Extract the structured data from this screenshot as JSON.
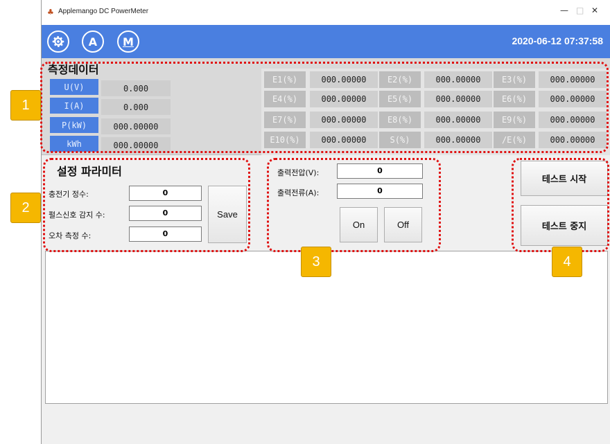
{
  "window": {
    "title": "Applemango DC PowerMeter",
    "icon": "apple-icon",
    "controls": [
      "—",
      "□",
      "✕"
    ]
  },
  "toolbar": {
    "icons": [
      "gear-icon",
      "auto-mode-icon",
      "manual-mode-icon"
    ],
    "auto_letter": "A",
    "manual_letter": "M",
    "datetime": "2020-06-12 07:37:58",
    "color": "#4a7fe0"
  },
  "measurement": {
    "title": "측정데이터",
    "rows": [
      {
        "label": "U(V)",
        "value": "0.000"
      },
      {
        "label": "I(A)",
        "value": "0.000"
      },
      {
        "label": "P(kW)",
        "value": "000.00000"
      },
      {
        "label": "kWh",
        "value": "000.00000"
      }
    ],
    "errors": [
      {
        "label": "E1(%)",
        "value": "000.00000"
      },
      {
        "label": "E2(%)",
        "value": "000.00000"
      },
      {
        "label": "E3(%)",
        "value": "000.00000"
      },
      {
        "label": "E4(%)",
        "value": "000.00000"
      },
      {
        "label": "E5(%)",
        "value": "000.00000"
      },
      {
        "label": "E6(%)",
        "value": "000.00000"
      },
      {
        "label": "E7(%)",
        "value": "000.00000"
      },
      {
        "label": "E8(%)",
        "value": "000.00000"
      },
      {
        "label": "E9(%)",
        "value": "000.00000"
      },
      {
        "label": "E10(%)",
        "value": "000.00000"
      },
      {
        "label": "S(%)",
        "value": "000.00000"
      },
      {
        "label": "/E(%)",
        "value": "000.00000"
      }
    ]
  },
  "settings": {
    "title": "설정 파라미터",
    "params": [
      {
        "label": "충전기 정수:",
        "value": "0"
      },
      {
        "label": "펄스신호 감지 수:",
        "value": "0"
      },
      {
        "label": "오차 측정 수:",
        "value": "0"
      }
    ],
    "save_label": "Save"
  },
  "output": {
    "voltage_label": "출력전압(V):",
    "voltage_value": "0",
    "current_label": "출력전류(A):",
    "current_value": "0",
    "on_label": "On",
    "off_label": "Off"
  },
  "test": {
    "start_label": "테스트 시작",
    "stop_label": "테스트 중지"
  },
  "annotations": {
    "badges": [
      "1",
      "2",
      "3",
      "4"
    ],
    "ring_color": "#e01010",
    "badge_color": "#f5b700"
  }
}
